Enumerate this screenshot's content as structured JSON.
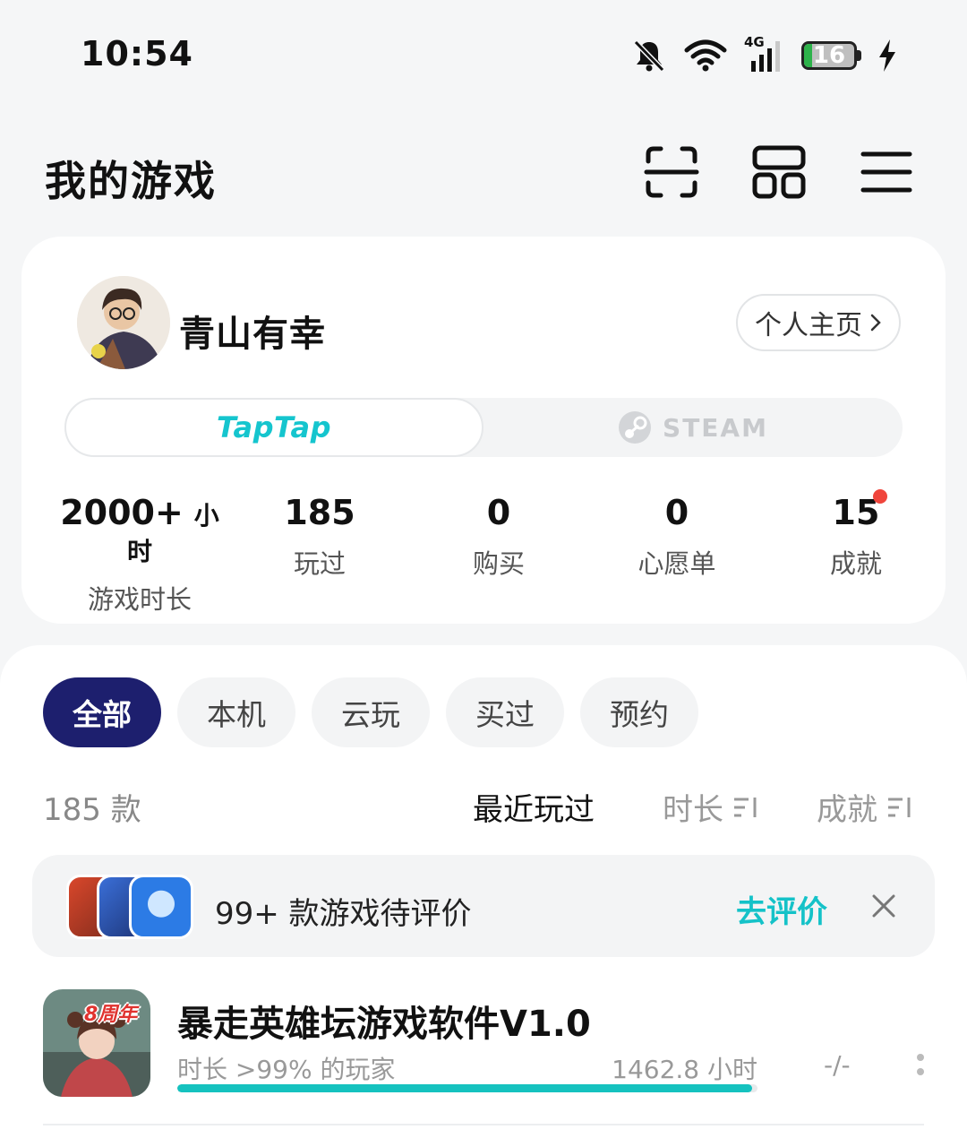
{
  "status_bar": {
    "time": "10:54",
    "network": "4G",
    "battery": "16",
    "battery_level_pct": 16,
    "icons": [
      "bell-muted-icon",
      "wifi-icon",
      "cellular-signal-icon",
      "battery-icon",
      "charging-icon"
    ]
  },
  "header": {
    "title": "我的游戏",
    "icons": [
      "scan-icon",
      "grid-icon",
      "menu-icon"
    ]
  },
  "profile": {
    "username": "青山有幸",
    "home_button": "个人主页",
    "platforms": [
      "TapTap",
      "STEAM"
    ],
    "active_platform": "TapTap",
    "stats": [
      {
        "value": "2000+",
        "unit": "小时",
        "label": "游戏时长"
      },
      {
        "value": "185",
        "label": "玩过"
      },
      {
        "value": "0",
        "label": "购买"
      },
      {
        "value": "0",
        "label": "心愿单"
      },
      {
        "value": "15",
        "label": "成就",
        "has_badge": true
      }
    ]
  },
  "games": {
    "filters": [
      "全部",
      "本机",
      "云玩",
      "买过",
      "预约"
    ],
    "active_filter": "全部",
    "count": "185 款",
    "sorts": [
      "最近玩过",
      "时长",
      "成就"
    ],
    "active_sort": "最近玩过",
    "review_banner": {
      "text": "99+ 款游戏待评价",
      "action": "去评价"
    },
    "items": [
      {
        "name": "暴走英雄坛游戏软件V1.0",
        "rank_text": "时长 >99% 的玩家",
        "hours": "1462.8 小时",
        "progress_pct": 99,
        "achievements": "-/-",
        "icon_badge": "8周年"
      }
    ]
  },
  "colors": {
    "accent_teal": "#15c2c8",
    "active_chip": "#1d1f6e",
    "badge_red": "#f0453c",
    "battery_green": "#2db24a"
  }
}
